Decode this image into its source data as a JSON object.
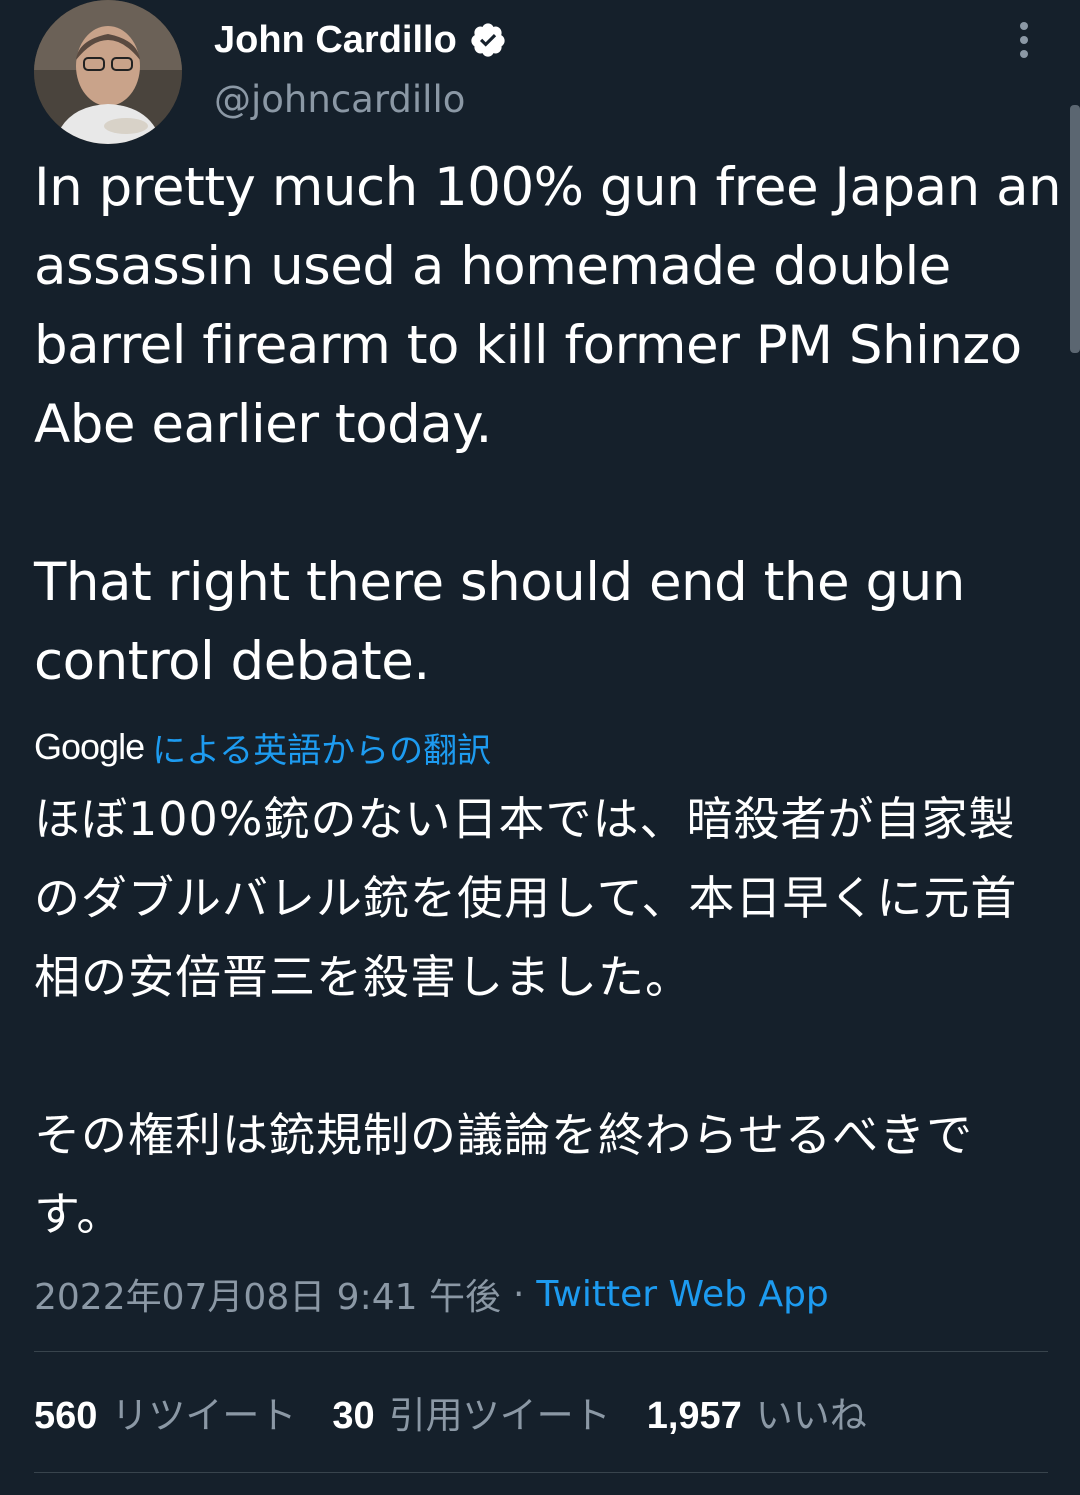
{
  "author": {
    "display_name": "John Cardillo",
    "handle": "@johncardillo",
    "verified": true,
    "avatar_icon": "profile-photo"
  },
  "tweet": {
    "text_paragraphs": [
      "In pretty much 100% gun free Japan an assassin used a homemade double barrel firearm to kill former PM Shinzo Abe earlier today.",
      "That right there should end the gun control debate."
    ],
    "translation": {
      "provider": "Google",
      "label": "による英語からの翻訳",
      "paragraphs": [
        "ほぼ100%銃のない日本では、暗殺者が自家製のダブルバレル銃を使用して、本日早くに元首相の安倍晋三を殺害しました。",
        "その権利は銃規制の議論を終わらせるべきです。"
      ]
    },
    "timestamp": "2022年07月08日 9:41 午後",
    "separator": "·",
    "source": "Twitter Web App"
  },
  "stats": {
    "retweets": {
      "count": "560",
      "label": "リツイート"
    },
    "quotes": {
      "count": "30",
      "label": "引用ツイート"
    },
    "likes": {
      "count": "1,957",
      "label": "いいね"
    }
  },
  "colors": {
    "background": "#15202b",
    "text_primary": "#ffffff",
    "text_secondary": "#8b98a5",
    "link": "#1d9bf0",
    "divider": "#38444d"
  }
}
